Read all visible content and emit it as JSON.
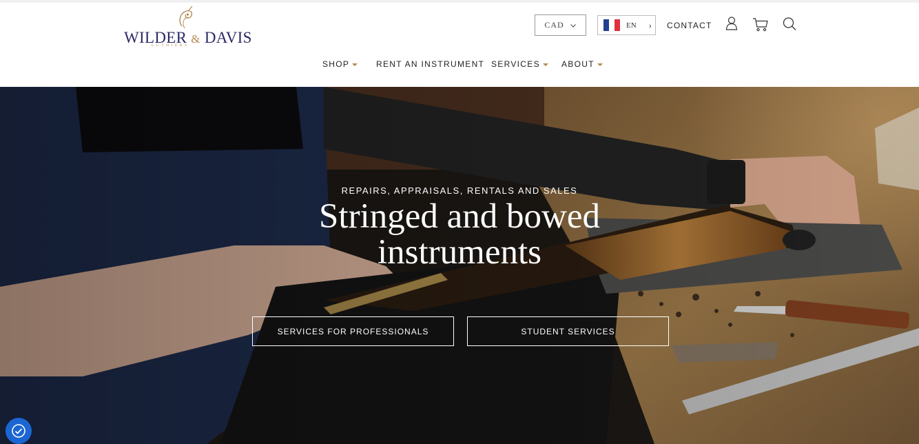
{
  "brand": {
    "name_first": "Wilder",
    "name_amp": "&",
    "name_last": "Davis",
    "tagline": "LUTHIERS"
  },
  "header": {
    "currency": "CAD",
    "language": "EN",
    "contact": "CONTACT",
    "icons": [
      "user-icon",
      "cart-icon",
      "search-icon"
    ]
  },
  "nav": {
    "items": [
      {
        "label": "SHOP",
        "has_dropdown": true
      },
      {
        "label": "RENT AN INSTRUMENT",
        "has_dropdown": false
      },
      {
        "label": "SERVICES",
        "has_dropdown": true
      },
      {
        "label": "ABOUT",
        "has_dropdown": true
      }
    ]
  },
  "hero": {
    "eyebrow": "REPAIRS, APPRAISALS, RENTALS AND SALES",
    "headline_line1": "Stringed and bowed",
    "headline_line2": "instruments",
    "buttons": {
      "professionals": "SERVICES FOR PROFESSIONALS",
      "students": "STUDENT SERVICES"
    }
  },
  "colors": {
    "brand_navy": "#2b2a66",
    "brand_gold": "#b38a53",
    "accessibility_blue": "#1b66d2"
  }
}
